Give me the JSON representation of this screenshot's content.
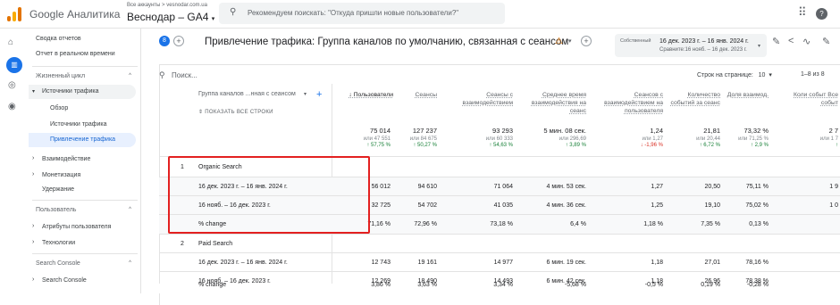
{
  "app": {
    "title": "Google Аналитика",
    "account_path": "Все аккаунты > vesnodar.com.ua",
    "property": "Веснодар – GA4",
    "search_placeholder": "Рекомендуем поискать: \"Откуда пришли новые пользователи?\""
  },
  "sidebar": {
    "items": [
      {
        "label": "Сводка отчетов"
      },
      {
        "label": "Отчет в реальном времени"
      },
      {
        "label": "Жизненный цикл",
        "chevron": "^"
      },
      {
        "label": "Источники трафика",
        "arrow": "▾"
      },
      {
        "label": "Обзор"
      },
      {
        "label": "Источники трафика"
      },
      {
        "label": "Привлечение трафика"
      },
      {
        "label": "Взаимодействие",
        "arrow": "›"
      },
      {
        "label": "Монетизация",
        "arrow": "›"
      },
      {
        "label": "Удержание"
      },
      {
        "label": "Пользователь",
        "chevron": "^"
      },
      {
        "label": "Атрибуты пользователя",
        "arrow": "›"
      },
      {
        "label": "Технологии",
        "arrow": "›"
      },
      {
        "label": "Search Console",
        "chevron": "^"
      },
      {
        "label": "Search Console",
        "arrow": "›"
      }
    ]
  },
  "report": {
    "badge": "8",
    "title": "Привлечение трафика: Группа каналов по умолчанию, связанная с сеансом",
    "date_label": "Собственный",
    "date_range": "16 дек. 2023 г. – 16 янв. 2024 г.",
    "compare_range": "Сравните:16 нояб. – 16 дек. 2023 г."
  },
  "table": {
    "search_placeholder": "Поиск...",
    "rows_per_page_label": "Строк на странице:",
    "rows_per_page": "10",
    "pagination": "1–8 из 8",
    "dimension_header": "Группа каналов ...нная с сеансом",
    "show_all_rows": "ПОКАЗАТЬ ВСЕ СТРОКИ",
    "metric_headers": [
      "↓ Пользователи",
      "Сеансы",
      "Сеансы с взаимодействием",
      "Среднее время взаимодействия на сеанс",
      "Сеансов с взаимодействием на пользователя",
      "Количество событий за сеанс",
      "Доля взаимод.",
      "Коли событ Все событ"
    ],
    "totals": [
      {
        "value": "75 014",
        "prev": "или 47 551",
        "change": "↑ 57,75 %",
        "dir": "up"
      },
      {
        "value": "127 237",
        "prev": "или 84 675",
        "change": "↑ 50,27 %",
        "dir": "up"
      },
      {
        "value": "93 293",
        "prev": "или 60 333",
        "change": "↑ 54,63 %",
        "dir": "up"
      },
      {
        "value": "5 мин. 08 сек.",
        "prev": "или 296,69",
        "change": "↑ 3,89 %",
        "dir": "up"
      },
      {
        "value": "1,24",
        "prev": "или 1,27",
        "change": "↓ -1,96 %",
        "dir": "down"
      },
      {
        "value": "21,81",
        "prev": "или 20,44",
        "change": "↑ 6,72 %",
        "dir": "up"
      },
      {
        "value": "73,32 %",
        "prev": "или 71,25 %",
        "change": "↑ 2,9 %",
        "dir": "up"
      },
      {
        "value": "2 7",
        "prev": "или 1 7",
        "change": "↑",
        "dir": "up"
      }
    ],
    "groups": [
      {
        "index": "1",
        "name": "Organic Search",
        "rows": [
          {
            "label": "16 дек. 2023 г. – 16 янв. 2024 г.",
            "values": [
              "56 012",
              "94 610",
              "71 064",
              "4 мин. 53 сек.",
              "1,27",
              "20,50",
              "75,11 %",
              "1 9"
            ]
          },
          {
            "label": "16 нояб. – 16 дек. 2023 г.",
            "values": [
              "32 725",
              "54 702",
              "41 035",
              "4 мин. 36 сек.",
              "1,25",
              "19,10",
              "75,02 %",
              "1 0"
            ]
          },
          {
            "label": "% change",
            "values": [
              "71,16 %",
              "72,96 %",
              "73,18 %",
              "6,4 %",
              "1,18 %",
              "7,35 %",
              "0,13 %",
              ""
            ]
          }
        ]
      },
      {
        "index": "2",
        "name": "Paid Search",
        "rows": [
          {
            "label": "16 дек. 2023 г. – 16 янв. 2024 г.",
            "values": [
              "12 743",
              "19 161",
              "14 977",
              "6 мин. 19 сек.",
              "1,18",
              "27,01",
              "78,16 %",
              ""
            ]
          },
          {
            "label": "16 нояб. – 16 дек. 2023 г.",
            "values": [
              "12 269",
              "18 490",
              "14 493",
              "6 мин. 42 сек.",
              "1,18",
              "26,96",
              "78,38 %",
              ""
            ]
          },
          {
            "label": "% change",
            "values": [
              "3,86 %",
              "3,63 %",
              "3,34 %",
              "-5,68 %",
              "-0,5 %",
              "0,19 %",
              "-0,28 %",
              ""
            ]
          }
        ]
      }
    ]
  },
  "colors": {
    "accent": "#1a73e8",
    "highlight_box": "#e32020",
    "positive": "#188038",
    "negative": "#d93025",
    "warning": "#e37400"
  }
}
